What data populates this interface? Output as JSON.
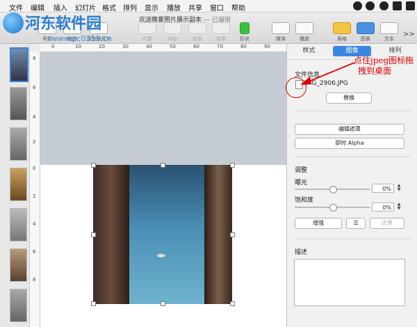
{
  "menubar": {
    "items": [
      "文件",
      "编辑",
      "插入",
      "幻灯片",
      "格式",
      "排列",
      "显示",
      "播放",
      "共享",
      "窗口",
      "帮助"
    ]
  },
  "window": {
    "document_title": "欢送晚宴照片展示副本",
    "edited_status": "— 已编辑"
  },
  "toolbar": {
    "left_labels": [
      "号数",
      "缩放",
      "添加幻灯片"
    ],
    "center_labels": [
      "内置",
      "向前",
      "前面",
      "前置",
      "形状"
    ],
    "right_labels": [
      "媒体",
      "播放"
    ],
    "far_right_labels": [
      "表格",
      "图表",
      "文本"
    ],
    "overflow": ">>"
  },
  "watermark": {
    "title": "河东软件园",
    "url": "www.pc0359.cn"
  },
  "rulers": {
    "horizontal": [
      "0",
      "10",
      "20",
      "30",
      "40",
      "50",
      "60",
      "70",
      "80",
      "90"
    ],
    "vertical_top": [
      "8",
      "6",
      "4",
      "2"
    ],
    "vertical_bottom": [
      "0",
      "2",
      "4",
      "6",
      "8"
    ]
  },
  "inspector": {
    "tabs": [
      "样式",
      "图像",
      "排列"
    ],
    "active_tab": "图像",
    "file_info_label": "文件信息",
    "file_name": "IMG_2906.JPG",
    "replace_button": "替换",
    "edit_mask_button": "编辑遮罩",
    "instant_alpha_button": "即时 Alpha",
    "adjust_label": "调整",
    "exposure_label": "曝光",
    "exposure_value": "0%",
    "saturation_label": "饱和度",
    "saturation_value": "0%",
    "enhance_button": "增强",
    "reset_button": "还原",
    "description_label": "描述"
  },
  "annotation": {
    "line1": "点住jpeg图标拖",
    "line2": "拽到桌面",
    "color": "#e00000"
  },
  "accent_color": "#3a87e0"
}
